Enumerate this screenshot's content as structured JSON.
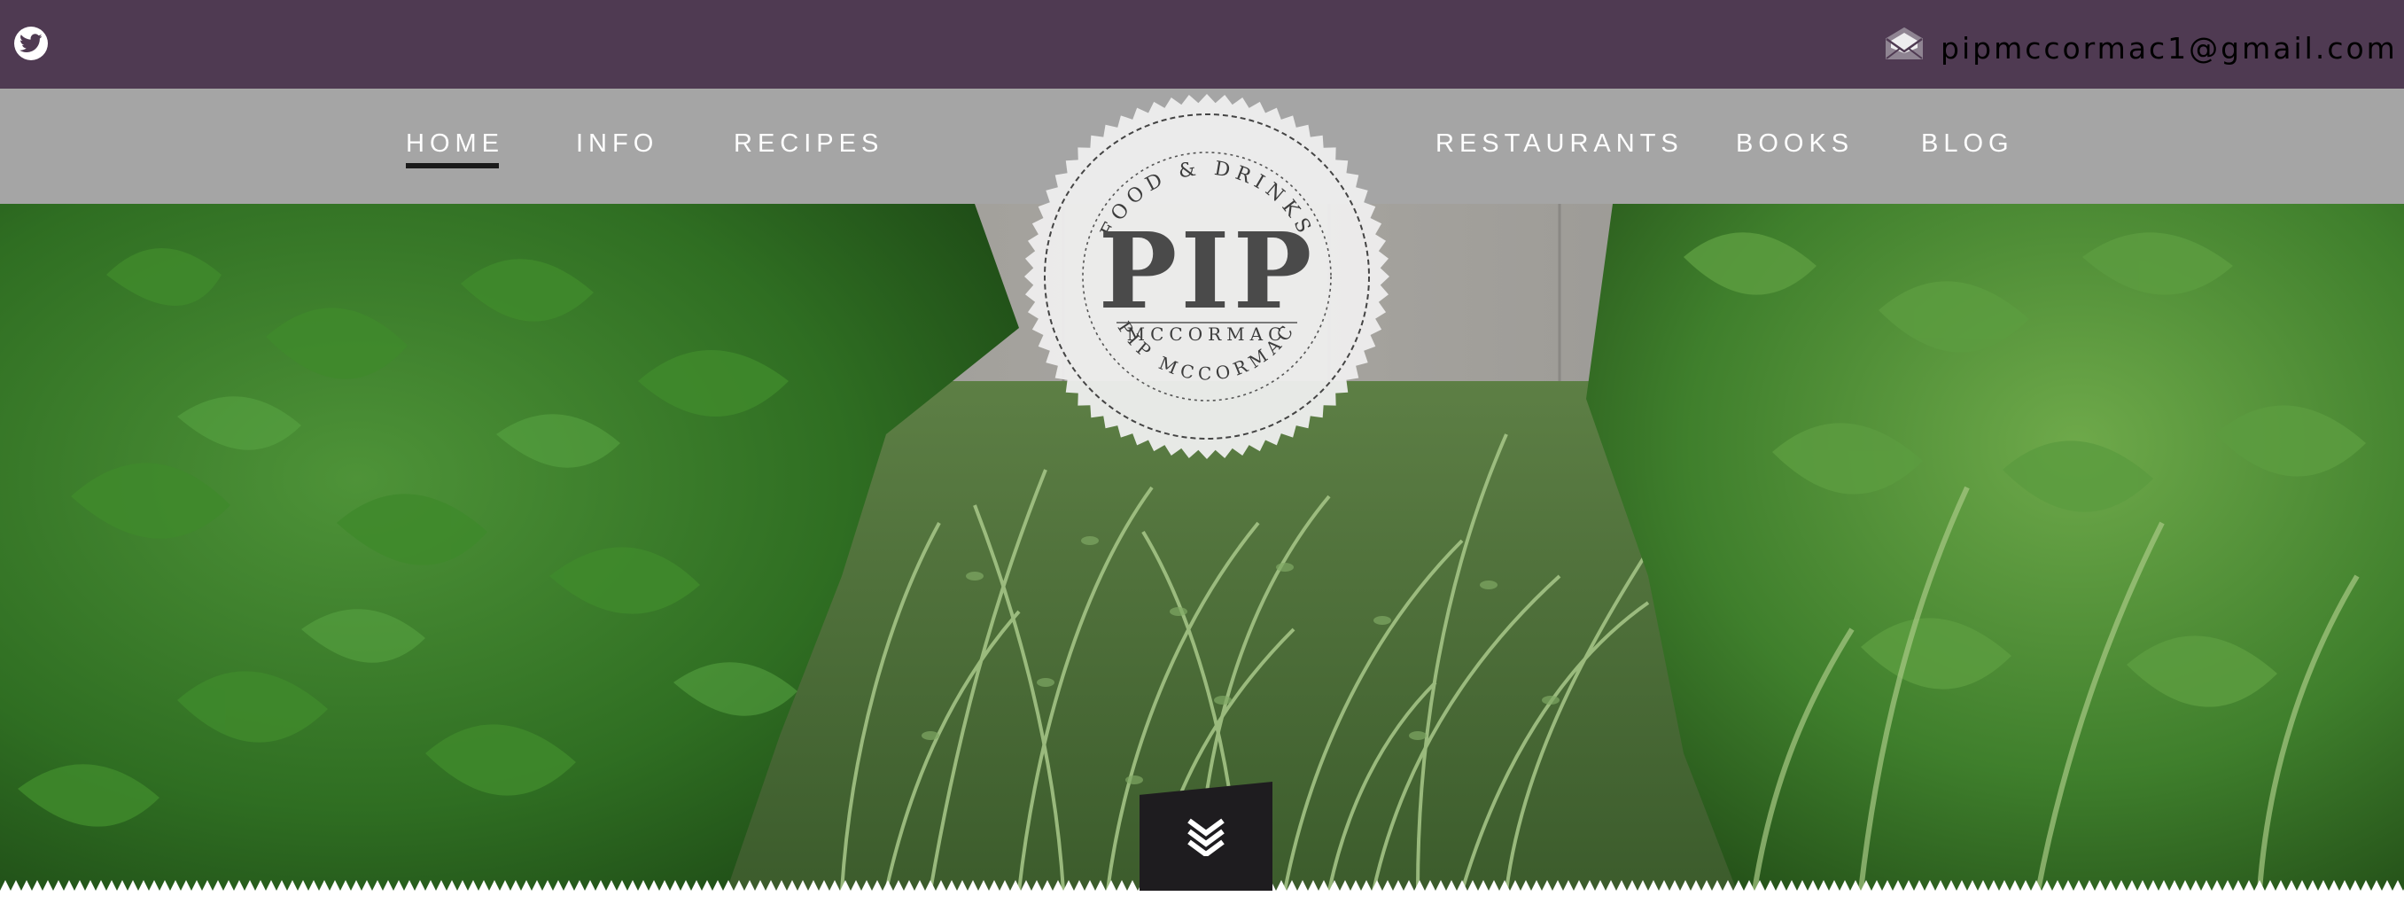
{
  "topbar": {
    "social_icon": "twitter-icon",
    "mail_icon": "envelope-icon",
    "email": "pipmccormac1@gmail.com"
  },
  "nav": {
    "left_items": [
      {
        "label": "HOME",
        "active": true
      },
      {
        "label": "INFO",
        "active": false
      },
      {
        "label": "RECIPES",
        "active": false
      }
    ],
    "right_items": [
      {
        "label": "RESTAURANTS",
        "active": false
      },
      {
        "label": "BOOKS",
        "active": false
      },
      {
        "label": "BLOG",
        "active": false
      }
    ]
  },
  "logo": {
    "top_arc": "FOOD & DRINKS",
    "name": "PIP",
    "surname": "MCCORMAC",
    "bottom_arc": "PIP MCCORMAC"
  },
  "hero": {
    "scroll_icon": "double-chevron-down-icon"
  },
  "colors": {
    "topbar_bg": "#4f3a52",
    "navbar_bg": "#a5a5a5",
    "nav_text": "#ffffff",
    "active_underline": "#1a1a1a",
    "scroll_button_bg": "#1e1c1f"
  }
}
